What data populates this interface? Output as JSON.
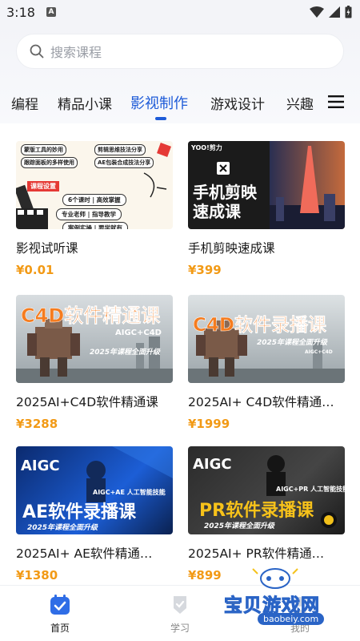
{
  "status_bar": {
    "time": "3:18"
  },
  "search": {
    "placeholder": "搜索课程"
  },
  "tabs": [
    {
      "label": "编程"
    },
    {
      "label": "精品小课"
    },
    {
      "label": "影视制作",
      "active": true
    },
    {
      "label": "游戏设计"
    },
    {
      "label": "兴趣"
    }
  ],
  "courses": [
    {
      "title": "影视试听课",
      "price": "¥0.01",
      "thumb": {
        "tags": [
          "蒙版工具的妙用",
          "剪辑思维技法分享",
          "跟踪面板的多样使用",
          "AE包装合成技法分享",
          "课程设置",
          "6个课时 | 高效掌握",
          "专业老师 | 指导教学",
          "案例实操 | 要学就有"
        ]
      }
    },
    {
      "title": "手机剪映速成课",
      "price": "¥399",
      "thumb": {
        "brand": "YOO!剪力",
        "headline": [
          "手机剪映",
          "速成课"
        ]
      }
    },
    {
      "title": "2025AI+C4D软件精通课",
      "price": "¥3288",
      "thumb": {
        "headline": "C4D软件精通课",
        "sub": "AIGC+C4D",
        "banner": "2025年课程全面升级"
      }
    },
    {
      "title": "2025AI+ C4D软件精通…",
      "price": "¥1999",
      "thumb": {
        "headline": "C4D软件录播课",
        "banner": "2025年课程全面升级",
        "sub": "AIGC+C4D"
      }
    },
    {
      "title": "2025AI+ AE软件精通…",
      "price": "¥1380",
      "thumb": {
        "top": "AIGC",
        "sub": "AIGC+AE 人工智能技能",
        "headline": "AE软件录播课",
        "banner": "2025年课程全面升级"
      }
    },
    {
      "title": "2025AI+ PR软件精通…",
      "price": "¥899",
      "thumb": {
        "top": "AIGC",
        "sub": "AIGC+PR 人工智能技能",
        "headline": "PR软件录播课",
        "banner": "2025年课程全面升级"
      }
    }
  ],
  "bottom_nav": [
    {
      "label": "首页",
      "active": true
    },
    {
      "label": "学习",
      "active": false
    },
    {
      "label": "我的",
      "active": false
    }
  ],
  "watermark": {
    "text": "宝贝游戏网",
    "url": "baobeiy.com"
  },
  "colors": {
    "accent": "#1e5bd8",
    "price": "#f29a16"
  }
}
